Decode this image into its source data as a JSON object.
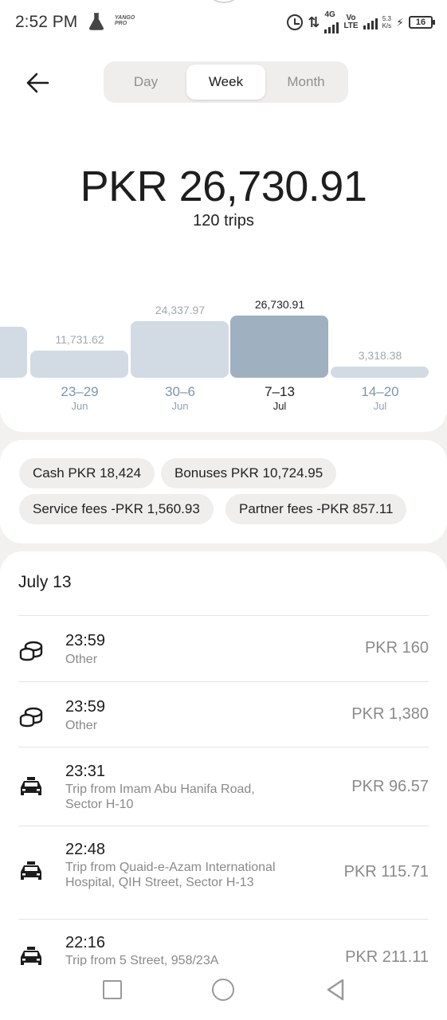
{
  "status_bar": {
    "time": "2:52 PM",
    "brand": "YANGO PRO",
    "network_type": "4G",
    "volte_top": "Vo",
    "volte_bottom": "LTE",
    "speed_value": "5.3",
    "speed_unit": "K/s",
    "battery": "16"
  },
  "header": {
    "back_icon": "back-arrow-icon",
    "tabs": [
      {
        "label": "Day",
        "active": false
      },
      {
        "label": "Week",
        "active": true
      },
      {
        "label": "Month",
        "active": false
      }
    ]
  },
  "summary": {
    "total": "PKR 26,730.91",
    "trips": "120 trips"
  },
  "chart_data": {
    "type": "bar",
    "categories": [
      "23–29 Jun",
      "30–6 Jun",
      "7–13 Jul",
      "14–20 Jul"
    ],
    "values": [
      11731.62,
      24337.97,
      26730.91,
      3318.38
    ],
    "value_labels": [
      "11,731.62",
      "24,337.97",
      "26,730.91",
      "3,318.38"
    ],
    "category_top": [
      "23–29",
      "30–6",
      "7–13",
      "14–20"
    ],
    "category_bottom": [
      "Jun",
      "Jun",
      "Jul",
      "Jul"
    ],
    "selected_index": 2,
    "title": "",
    "xlabel": "",
    "ylabel": "",
    "colors": {
      "bar": "#d2dbe3",
      "selected": "#9fb1c0"
    }
  },
  "breakdown": {
    "chips": [
      {
        "label": "Cash PKR 18,424"
      },
      {
        "label": "Bonuses PKR 10,724.95"
      },
      {
        "label": "Service fees -PKR 1,560.93"
      },
      {
        "label": "Partner fees -PKR 857.11"
      }
    ]
  },
  "transactions": {
    "date_heading": "July 13",
    "items": [
      {
        "icon": "coins-icon",
        "time": "23:59",
        "desc": "Other",
        "amount": "PKR 160"
      },
      {
        "icon": "coins-icon",
        "time": "23:59",
        "desc": "Other",
        "amount": "PKR 1,380"
      },
      {
        "icon": "taxi-icon",
        "time": "23:31",
        "desc": "Trip from Imam Abu Hanifa Road, Sector H-10",
        "amount": "PKR 96.57"
      },
      {
        "icon": "taxi-icon",
        "time": "22:48",
        "desc": "Trip from Quaid-e-Azam International Hospital, QIH Street, Sector H-13",
        "amount": "PKR 115.71"
      },
      {
        "icon": "taxi-icon",
        "time": "22:16",
        "desc": "Trip from 5 Street, 958/23A",
        "amount": "PKR 211.11"
      }
    ]
  },
  "navbar": {
    "icons": [
      "recent-apps-icon",
      "home-icon",
      "back-triangle-icon"
    ]
  }
}
